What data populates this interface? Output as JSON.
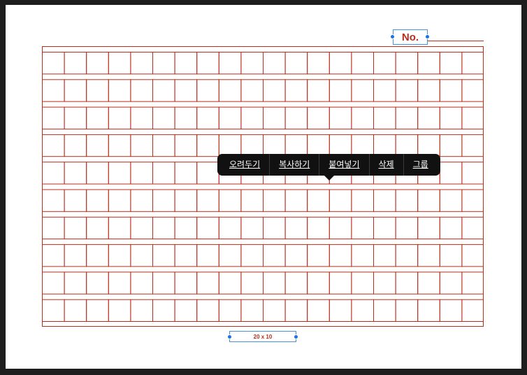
{
  "header": {
    "no_label": "No."
  },
  "grid": {
    "columns": 20,
    "rows": 10,
    "line_color": "#b82e1c",
    "size_label": "20 x 10"
  },
  "context_menu": {
    "items": [
      {
        "label": "오려두기"
      },
      {
        "label": "복사하기"
      },
      {
        "label": "붙여넣기"
      },
      {
        "label": "삭제"
      },
      {
        "label": "그룹"
      }
    ]
  },
  "colors": {
    "selection": "#4a90e2",
    "handle": "#1a73e8",
    "menu_bg": "#111111",
    "background": "#1e1e1e"
  }
}
